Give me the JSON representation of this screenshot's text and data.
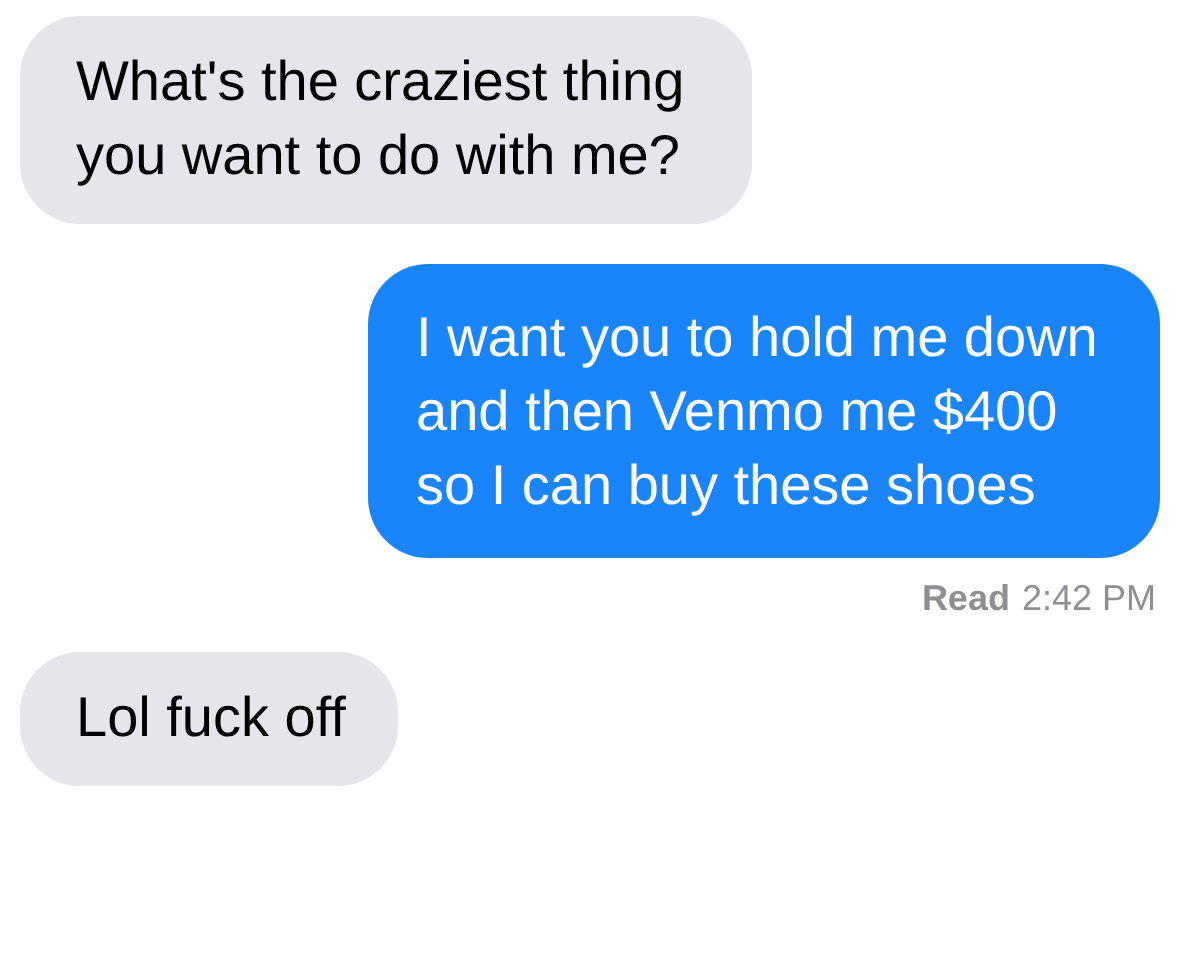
{
  "messages": [
    {
      "kind": "received",
      "text": "What's the craziest thing you want to do with me?"
    },
    {
      "kind": "sent",
      "text": "I want you to hold me down and then Venmo me $400 so I can buy these shoes"
    },
    {
      "kind": "receipt",
      "label": "Read",
      "time": "2:42 PM"
    },
    {
      "kind": "received",
      "text": "Lol fuck off"
    }
  ]
}
